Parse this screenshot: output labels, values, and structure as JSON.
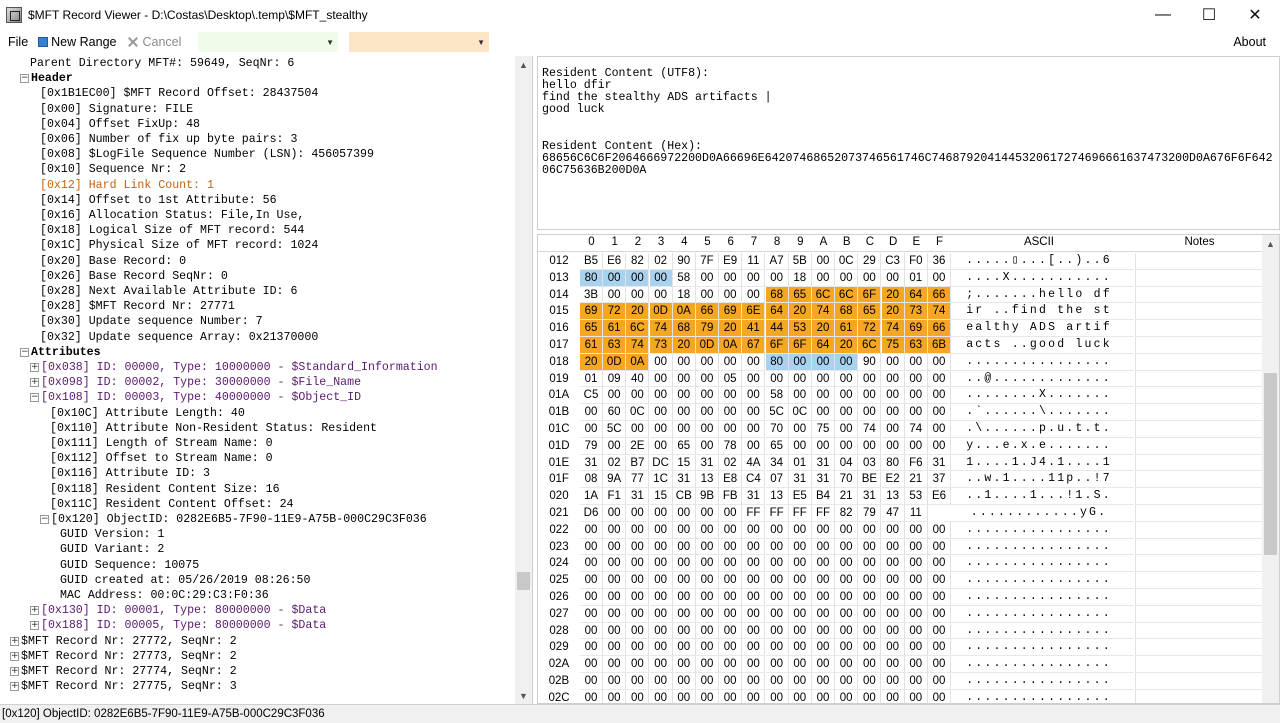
{
  "window": {
    "title": "$MFT Record Viewer - D:\\Costas\\Desktop\\.temp\\$MFT_stealthy",
    "minimize": "—",
    "maximize": "☐",
    "close": "✕"
  },
  "menu": {
    "file": "File",
    "new_range": "New Range",
    "cancel": "Cancel",
    "about": "About",
    "combo1_color": "#f0fbea",
    "combo2_color": "#fde6c6"
  },
  "tree": [
    {
      "indent": 3,
      "text": "Parent Directory MFT#: 59649, SeqNr: 6"
    },
    {
      "indent": 2,
      "toggle": "−",
      "text": "Header",
      "style": "bold"
    },
    {
      "indent": 4,
      "text": "[0x1B1EC00] $MFT Record Offset: 28437504"
    },
    {
      "indent": 4,
      "text": "[0x00] Signature: FILE"
    },
    {
      "indent": 4,
      "text": "[0x04] Offset FixUp: 48"
    },
    {
      "indent": 4,
      "text": "[0x06] Number of fix up byte pairs: 3"
    },
    {
      "indent": 4,
      "text": "[0x08] $LogFile Sequence Number (LSN): 456057399"
    },
    {
      "indent": 4,
      "text": "[0x10] Sequence Nr: 2"
    },
    {
      "indent": 4,
      "text": "[0x12] Hard Link Count: 1",
      "style": "orange"
    },
    {
      "indent": 4,
      "text": "[0x14] Offset to 1st Attribute: 56"
    },
    {
      "indent": 4,
      "text": "[0x16] Allocation Status: File,In Use,"
    },
    {
      "indent": 4,
      "text": "[0x18] Logical Size of MFT record: 544"
    },
    {
      "indent": 4,
      "text": "[0x1C] Physical Size of MFT record: 1024"
    },
    {
      "indent": 4,
      "text": "[0x20] Base Record: 0"
    },
    {
      "indent": 4,
      "text": "[0x26] Base Record SeqNr: 0"
    },
    {
      "indent": 4,
      "text": "[0x28] Next Available Attribute ID: 6"
    },
    {
      "indent": 4,
      "text": "[0x28] $MFT Record Nr: 27771"
    },
    {
      "indent": 4,
      "text": "[0x30] Update sequence Number: 7"
    },
    {
      "indent": 4,
      "text": "[0x32] Update sequence Array: 0x21370000"
    },
    {
      "indent": 2,
      "toggle": "−",
      "text": "Attributes",
      "style": "bold"
    },
    {
      "indent": 3,
      "toggle": "+",
      "text": "[0x038] ID: 00000, Type: 10000000 - $Standard_Information",
      "style": "purple"
    },
    {
      "indent": 3,
      "toggle": "+",
      "text": "[0x098] ID: 00002, Type: 30000000 - $File_Name",
      "style": "purple"
    },
    {
      "indent": 3,
      "toggle": "−",
      "text": "[0x108] ID: 00003, Type: 40000000 - $Object_ID",
      "style": "purple"
    },
    {
      "indent": 5,
      "text": "[0x10C] Attribute Length: 40"
    },
    {
      "indent": 5,
      "text": "[0x110] Attribute Non-Resident Status: Resident"
    },
    {
      "indent": 5,
      "text": "[0x111] Length of Stream Name: 0"
    },
    {
      "indent": 5,
      "text": "[0x112] Offset to Stream Name: 0"
    },
    {
      "indent": 5,
      "text": "[0x116] Attribute ID: 3"
    },
    {
      "indent": 5,
      "text": "[0x118] Resident Content Size: 16"
    },
    {
      "indent": 5,
      "text": "[0x11C] Resident Content Offset: 24"
    },
    {
      "indent": 4,
      "toggle": "−",
      "text": "[0x120] ObjectID: 0282E6B5-7F90-11E9-A75B-000C29C3F036"
    },
    {
      "indent": 6,
      "text": "GUID Version: 1"
    },
    {
      "indent": 6,
      "text": "GUID Variant: 2"
    },
    {
      "indent": 6,
      "text": "GUID Sequence: 10075"
    },
    {
      "indent": 6,
      "text": "GUID created at: 05/26/2019 08:26:50"
    },
    {
      "indent": 6,
      "text": "MAC Address: 00:0C:29:C3:F0:36"
    },
    {
      "indent": 3,
      "toggle": "+",
      "text": "[0x130] ID: 00001, Type: 80000000 - $Data",
      "style": "purple"
    },
    {
      "indent": 3,
      "toggle": "+",
      "text": "[0x188] ID: 00005, Type: 80000000 - $Data",
      "style": "purple"
    },
    {
      "indent": 1,
      "toggle": "+",
      "text": "$MFT Record Nr: 27772, SeqNr: 2"
    },
    {
      "indent": 1,
      "toggle": "+",
      "text": "$MFT Record Nr: 27773, SeqNr: 2"
    },
    {
      "indent": 1,
      "toggle": "+",
      "text": "$MFT Record Nr: 27774, SeqNr: 2"
    },
    {
      "indent": 1,
      "toggle": "+",
      "text": "$MFT Record Nr: 27775, SeqNr: 3"
    }
  ],
  "resident": {
    "utf8_label": "Resident Content (UTF8):",
    "utf8_lines": [
      "hello dfir",
      "find the stealthy ADS artifacts |",
      "good luck"
    ],
    "hex_label": "Resident Content (Hex):",
    "hex_lines": [
      "68656C6C6F2064666972200D0A66696E64207468652073746561746C7468792041445320617274696661637473200D0A676F6F642",
      "06C75636B200D0A"
    ]
  },
  "hex": {
    "columns": [
      "0",
      "1",
      "2",
      "3",
      "4",
      "5",
      "6",
      "7",
      "8",
      "9",
      "A",
      "B",
      "C",
      "D",
      "E",
      "F"
    ],
    "ascii_label": "ASCII",
    "notes_label": "Notes",
    "highlight_orange": "#f5a623",
    "highlight_blue": "#a9d2ef",
    "rows": [
      {
        "off": "012",
        "b": [
          "B5",
          "E6",
          "82",
          "02",
          "90",
          "7F",
          "E9",
          "11",
          "A7",
          "5B",
          "00",
          "0C",
          "29",
          "C3",
          "F0",
          "36"
        ],
        "a": ".....▯...[..)..6"
      },
      {
        "off": "013",
        "b": [
          "80",
          "00",
          "00",
          "00",
          "58",
          "00",
          "00",
          "00",
          "00",
          "18",
          "00",
          "00",
          "00",
          "00",
          "01",
          "00"
        ],
        "a": "....X..........."
      },
      {
        "off": "014",
        "b": [
          "3B",
          "00",
          "00",
          "00",
          "18",
          "00",
          "00",
          "00",
          "68",
          "65",
          "6C",
          "6C",
          "6F",
          "20",
          "64",
          "66"
        ],
        "a": ";.......hello df"
      },
      {
        "off": "015",
        "b": [
          "69",
          "72",
          "20",
          "0D",
          "0A",
          "66",
          "69",
          "6E",
          "64",
          "20",
          "74",
          "68",
          "65",
          "20",
          "73",
          "74"
        ],
        "a": "ir ..find the st"
      },
      {
        "off": "016",
        "b": [
          "65",
          "61",
          "6C",
          "74",
          "68",
          "79",
          "20",
          "41",
          "44",
          "53",
          "20",
          "61",
          "72",
          "74",
          "69",
          "66"
        ],
        "a": "ealthy ADS artif"
      },
      {
        "off": "017",
        "b": [
          "61",
          "63",
          "74",
          "73",
          "20",
          "0D",
          "0A",
          "67",
          "6F",
          "6F",
          "64",
          "20",
          "6C",
          "75",
          "63",
          "6B"
        ],
        "a": "acts ..good luck"
      },
      {
        "off": "018",
        "b": [
          "20",
          "0D",
          "0A",
          "00",
          "00",
          "00",
          "00",
          "00",
          "80",
          "00",
          "00",
          "00",
          "90",
          "00",
          "00",
          "00"
        ],
        "a": "................"
      },
      {
        "off": "019",
        "b": [
          "01",
          "09",
          "40",
          "00",
          "00",
          "00",
          "05",
          "00",
          "00",
          "00",
          "00",
          "00",
          "00",
          "00",
          "00",
          "00"
        ],
        "a": "..@............."
      },
      {
        "off": "01A",
        "b": [
          "C5",
          "00",
          "00",
          "00",
          "00",
          "00",
          "00",
          "00",
          "58",
          "00",
          "00",
          "00",
          "00",
          "00",
          "00",
          "00"
        ],
        "a": "........X......."
      },
      {
        "off": "01B",
        "b": [
          "00",
          "60",
          "0C",
          "00",
          "00",
          "00",
          "00",
          "00",
          "5C",
          "0C",
          "00",
          "00",
          "00",
          "00",
          "00",
          "00"
        ],
        "a": ".`......\\......."
      },
      {
        "off": "01C",
        "b": [
          "00",
          "5C",
          "00",
          "00",
          "00",
          "00",
          "00",
          "00",
          "70",
          "00",
          "75",
          "00",
          "74",
          "00",
          "74",
          "00"
        ],
        "a": ".\\......p.u.t.t."
      },
      {
        "off": "01D",
        "b": [
          "79",
          "00",
          "2E",
          "00",
          "65",
          "00",
          "78",
          "00",
          "65",
          "00",
          "00",
          "00",
          "00",
          "00",
          "00",
          "00"
        ],
        "a": "y...e.x.e......."
      },
      {
        "off": "01E",
        "b": [
          "31",
          "02",
          "B7",
          "DC",
          "15",
          "31",
          "02",
          "4A",
          "34",
          "01",
          "31",
          "04",
          "03",
          "80",
          "F6",
          "31"
        ],
        "a": "1....1.J4.1....1"
      },
      {
        "off": "01F",
        "b": [
          "08",
          "9A",
          "77",
          "1C",
          "31",
          "13",
          "E8",
          "C4",
          "07",
          "31",
          "31",
          "70",
          "BE",
          "E2",
          "21",
          "37"
        ],
        "a": "..w.1....11p..!7"
      },
      {
        "off": "020",
        "b": [
          "1A",
          "F1",
          "31",
          "15",
          "CB",
          "9B",
          "FB",
          "31",
          "13",
          "E5",
          "B4",
          "21",
          "31",
          "13",
          "53",
          "E6"
        ],
        "a": "..1....1...!1.S."
      },
      {
        "off": "021",
        "b": [
          "D6",
          "00",
          "00",
          "00",
          "00",
          "00",
          "00",
          "FF",
          "FF",
          "FF",
          "FF",
          "82",
          "79",
          "47",
          "11"
        ],
        "a": "............yG."
      },
      {
        "off": "022",
        "b": [
          "00",
          "00",
          "00",
          "00",
          "00",
          "00",
          "00",
          "00",
          "00",
          "00",
          "00",
          "00",
          "00",
          "00",
          "00",
          "00"
        ],
        "a": "................"
      },
      {
        "off": "023",
        "b": [
          "00",
          "00",
          "00",
          "00",
          "00",
          "00",
          "00",
          "00",
          "00",
          "00",
          "00",
          "00",
          "00",
          "00",
          "00",
          "00"
        ],
        "a": "................"
      },
      {
        "off": "024",
        "b": [
          "00",
          "00",
          "00",
          "00",
          "00",
          "00",
          "00",
          "00",
          "00",
          "00",
          "00",
          "00",
          "00",
          "00",
          "00",
          "00"
        ],
        "a": "................"
      },
      {
        "off": "025",
        "b": [
          "00",
          "00",
          "00",
          "00",
          "00",
          "00",
          "00",
          "00",
          "00",
          "00",
          "00",
          "00",
          "00",
          "00",
          "00",
          "00"
        ],
        "a": "................"
      },
      {
        "off": "026",
        "b": [
          "00",
          "00",
          "00",
          "00",
          "00",
          "00",
          "00",
          "00",
          "00",
          "00",
          "00",
          "00",
          "00",
          "00",
          "00",
          "00"
        ],
        "a": "................"
      },
      {
        "off": "027",
        "b": [
          "00",
          "00",
          "00",
          "00",
          "00",
          "00",
          "00",
          "00",
          "00",
          "00",
          "00",
          "00",
          "00",
          "00",
          "00",
          "00"
        ],
        "a": "................"
      },
      {
        "off": "028",
        "b": [
          "00",
          "00",
          "00",
          "00",
          "00",
          "00",
          "00",
          "00",
          "00",
          "00",
          "00",
          "00",
          "00",
          "00",
          "00",
          "00"
        ],
        "a": "................"
      },
      {
        "off": "029",
        "b": [
          "00",
          "00",
          "00",
          "00",
          "00",
          "00",
          "00",
          "00",
          "00",
          "00",
          "00",
          "00",
          "00",
          "00",
          "00",
          "00"
        ],
        "a": "................"
      },
      {
        "off": "02A",
        "b": [
          "00",
          "00",
          "00",
          "00",
          "00",
          "00",
          "00",
          "00",
          "00",
          "00",
          "00",
          "00",
          "00",
          "00",
          "00",
          "00"
        ],
        "a": "................"
      },
      {
        "off": "02B",
        "b": [
          "00",
          "00",
          "00",
          "00",
          "00",
          "00",
          "00",
          "00",
          "00",
          "00",
          "00",
          "00",
          "00",
          "00",
          "00",
          "00"
        ],
        "a": "................"
      },
      {
        "off": "02C",
        "b": [
          "00",
          "00",
          "00",
          "00",
          "00",
          "00",
          "00",
          "00",
          "00",
          "00",
          "00",
          "00",
          "00",
          "00",
          "00",
          "00"
        ],
        "a": "................"
      }
    ],
    "highlights": [
      {
        "row": "013",
        "from": 0,
        "to": 3,
        "color": "blue"
      },
      {
        "row": "014",
        "from": 8,
        "to": 15,
        "color": "orange"
      },
      {
        "row": "015",
        "from": 0,
        "to": 15,
        "color": "orange"
      },
      {
        "row": "016",
        "from": 0,
        "to": 15,
        "color": "orange"
      },
      {
        "row": "017",
        "from": 0,
        "to": 15,
        "color": "orange"
      },
      {
        "row": "018",
        "from": 0,
        "to": 2,
        "color": "orange"
      },
      {
        "row": "018",
        "from": 8,
        "to": 11,
        "color": "blue"
      }
    ]
  },
  "status": {
    "text": "[0x120] ObjectID: 0282E6B5-7F90-11E9-A75B-000C29C3F036"
  }
}
